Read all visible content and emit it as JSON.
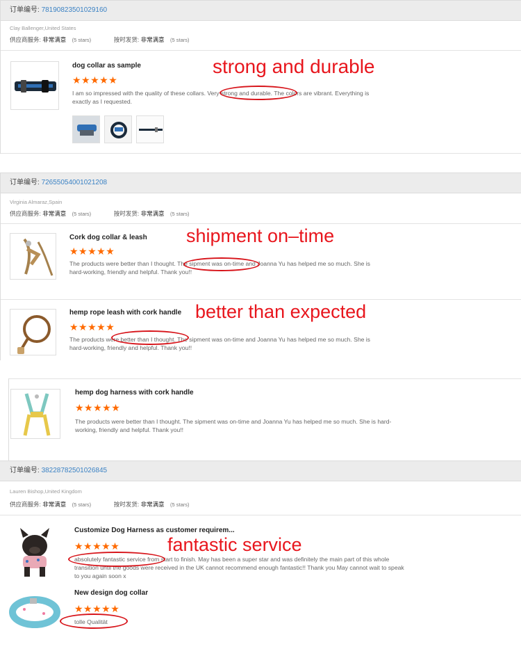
{
  "orders": [
    {
      "label": "订单编号:",
      "number": "78190823501029160",
      "customer": "Clay Ballenger,United States",
      "service_label": "供应商服务:",
      "service_value": "非常满意",
      "service_stars": "(5 stars)",
      "shipping_label": "按时发货:",
      "shipping_value": "非常满意",
      "shipping_stars": "(5 stars)"
    },
    {
      "label": "订单编号:",
      "number": "72655054001021208",
      "customer": "Virginia Almaraz,Spain",
      "service_label": "供应商服务:",
      "service_value": "非常满意",
      "service_stars": "(5 stars)",
      "shipping_label": "按时发货:",
      "shipping_value": "非常满意",
      "shipping_stars": "(5 stars)"
    },
    {
      "label": "订单编号:",
      "number": "38228782501026845",
      "customer": "Lauren Bishop,United Kingdom",
      "service_label": "供应商服务:",
      "service_value": "非常满意",
      "service_stars": "(5 stars)",
      "shipping_label": "按时发货:",
      "shipping_value": "非常满意",
      "shipping_stars": "(5 stars)"
    }
  ],
  "rating": "★★★★★",
  "rating_value": 5,
  "reviews": [
    {
      "title": "dog collar as sample",
      "text": "I am so impressed with the quality of these collars. Very strong and durable. The colors are vibrant. Everything is exactly as I requested."
    },
    {
      "title": "Cork dog collar & leash",
      "text": "The products were better than I thought. The sipment was on-time and Joanna Yu has helped me so much. She is hard-working, friendly and helpful. Thank you!!"
    },
    {
      "title": "hemp rope leash with cork handle",
      "text": "The products were better than I thought. The sipment was on-time and Joanna Yu has helped me so much. She is hard-working, friendly and helpful. Thank you!!"
    },
    {
      "title": "hemp dog harness with cork handle",
      "text": "The products were better than I thought. The sipment was on-time and Joanna Yu has helped me so much. She is hard-working, friendly and helpful. Thank you!!"
    },
    {
      "title": "Customize Dog Harness as customer requirem...",
      "text": "absolutely fantastic service from start to finish. May has been a super star and was definitely the main part of this whole transition until the goods were received in the UK cannot recommend enough fantastic!! Thank you May cannot wait to speak to you again soon x"
    },
    {
      "title": "New design dog collar",
      "text": "tolle Qualität"
    }
  ],
  "annotations": {
    "a1": "strong and durable",
    "a2": "shipment on–time",
    "a3": "better than expected",
    "a4": "fantastic service"
  },
  "colors": {
    "accent_red": "#e8161d",
    "star_orange": "#ff6a00",
    "order_number_blue": "#3b82c4"
  }
}
